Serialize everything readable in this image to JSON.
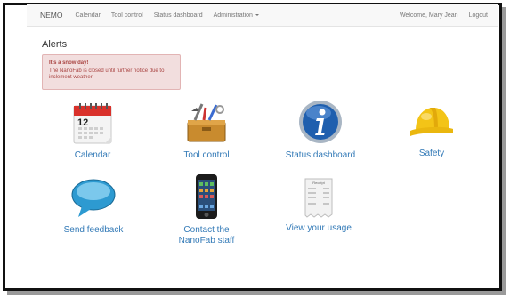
{
  "navbar": {
    "brand": "NEMO",
    "items": [
      {
        "label": "Calendar"
      },
      {
        "label": "Tool control"
      },
      {
        "label": "Status dashboard"
      },
      {
        "label": "Administration"
      }
    ],
    "welcome": "Welcome, Mary Jean",
    "logout": "Logout"
  },
  "alerts": {
    "title": "Alerts",
    "alert_heading": "It's a snow day!",
    "alert_body": "The NanoFab is closed until further notice due to inclement weather!"
  },
  "tiles": [
    {
      "label": "Calendar",
      "icon": "calendar-icon",
      "calendar_day": "12"
    },
    {
      "label": "Tool control",
      "icon": "toolbox-icon"
    },
    {
      "label": "Status dashboard",
      "icon": "info-icon"
    },
    {
      "label": "Safety",
      "icon": "hardhat-icon"
    },
    {
      "label": "Send feedback",
      "icon": "speech-bubble-icon"
    },
    {
      "label_line1": "Contact the",
      "label_line2": "NanoFab staff",
      "icon": "phone-icon"
    },
    {
      "label": "View your usage",
      "icon": "receipt-icon"
    }
  ],
  "receipt": {
    "title": "Receipt"
  },
  "colors": {
    "link": "#337ab7",
    "alert_bg": "#f2dede",
    "alert_text": "#a94442"
  }
}
